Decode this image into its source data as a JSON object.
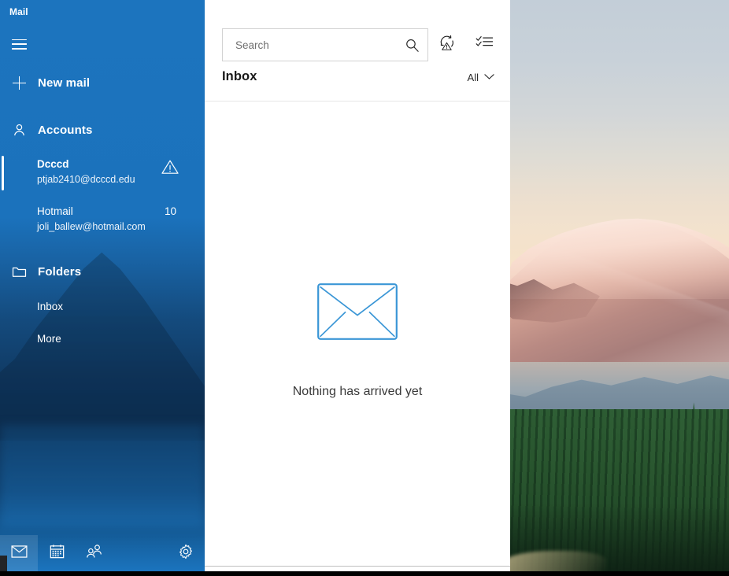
{
  "app": {
    "title": "Mail"
  },
  "nav": {
    "hamburger_icon": "hamburger-menu-icon",
    "new_mail": {
      "label": "New mail",
      "icon": "plus-icon"
    },
    "accounts_section": {
      "label": "Accounts",
      "icon": "person-icon",
      "items": [
        {
          "name": "Dcccd",
          "email": "ptjab2410@dcccd.edu",
          "badge": "",
          "status_icon": "warning-triangle-icon",
          "selected": true
        },
        {
          "name": "Hotmail",
          "email": "joli_ballew@hotmail.com",
          "badge": "10",
          "status_icon": "",
          "selected": false
        }
      ]
    },
    "folders_section": {
      "label": "Folders",
      "icon": "folder-icon",
      "items": [
        {
          "label": "Inbox"
        },
        {
          "label": "More"
        }
      ]
    },
    "bottom_bar": [
      {
        "name": "mail",
        "icon": "envelope-icon",
        "active": true
      },
      {
        "name": "calendar",
        "icon": "calendar-icon",
        "active": false
      },
      {
        "name": "people",
        "icon": "people-icon",
        "active": false
      },
      {
        "name": "settings",
        "icon": "gear-icon",
        "active": false
      }
    ]
  },
  "list_pane": {
    "search": {
      "placeholder": "Search",
      "value": "",
      "icon": "search-icon"
    },
    "toolbar": {
      "sync_icon": "sync-error-icon",
      "selection_icon": "selection-mode-icon"
    },
    "header": {
      "title": "Inbox",
      "filter_label": "All",
      "filter_chevron": "chevron-down-icon"
    },
    "empty_state": {
      "icon": "envelope-outline-icon",
      "message": "Nothing has arrived yet"
    }
  },
  "colors": {
    "accent_blue": "#1e74bf",
    "envelope_outline": "#3a96d6",
    "text_dark": "#1a1a1a",
    "divider": "#e6e6e6"
  }
}
